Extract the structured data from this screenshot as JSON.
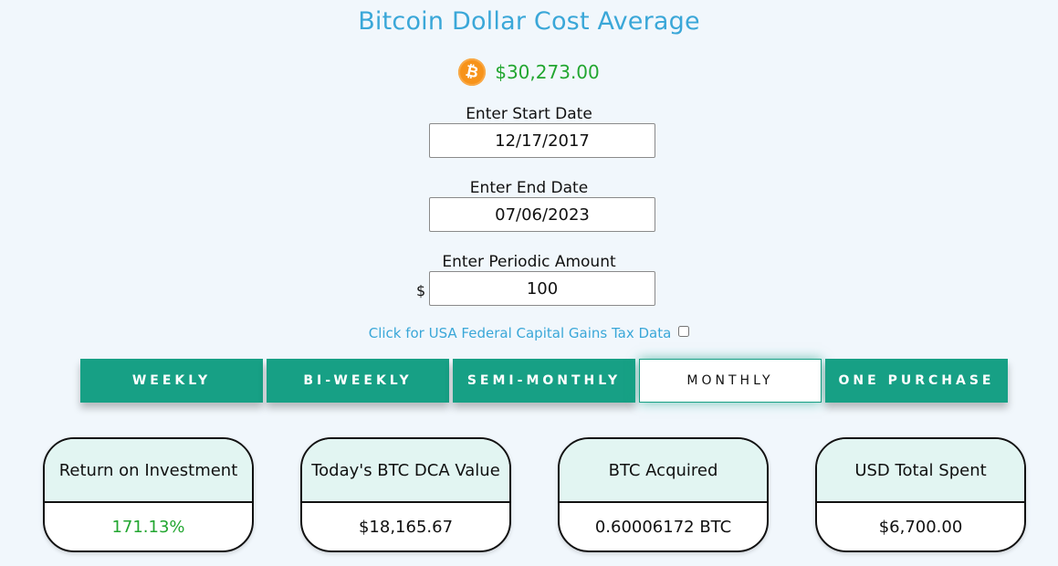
{
  "title": "Bitcoin Dollar Cost Average",
  "price": {
    "icon": "bitcoin-icon",
    "value": "$30,273.00",
    "color": "#22a630"
  },
  "start_date": {
    "label": "Enter Start Date",
    "value": "12/17/2017"
  },
  "end_date": {
    "label": "Enter End Date",
    "value": "07/06/2023"
  },
  "periodic_amount": {
    "label": "Enter Periodic Amount",
    "currency": "$",
    "value": "100"
  },
  "tax": {
    "label": "Click for USA Federal Capital Gains Tax Data",
    "checked": false
  },
  "frequencies": [
    {
      "label": "WEEKLY",
      "active": false
    },
    {
      "label": "BI-WEEKLY",
      "active": false
    },
    {
      "label": "SEMI-MONTHLY",
      "active": false
    },
    {
      "label": "MONTHLY",
      "active": true
    },
    {
      "label": "ONE PURCHASE",
      "active": false
    }
  ],
  "cards": [
    {
      "title": "Return on Investment",
      "value": "171.13%"
    },
    {
      "title": "Today's BTC DCA Value",
      "value": "$18,165.67"
    },
    {
      "title": "BTC Acquired",
      "value": "0.60006172 BTC"
    },
    {
      "title": "USD Total Spent",
      "value": "$6,700.00"
    }
  ],
  "colors": {
    "accent": "#17a085",
    "title": "#3aa7d8",
    "positive": "#22a630",
    "background": "#f1f7fc"
  }
}
